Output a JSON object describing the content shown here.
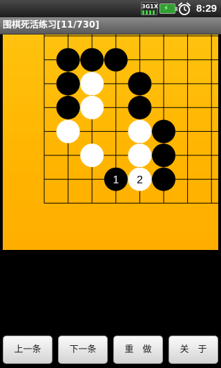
{
  "status_bar": {
    "network_label": "3G1X",
    "clock": "8:29",
    "icons": [
      "network-3g-icon",
      "battery-charging-icon",
      "alarm-clock-icon"
    ]
  },
  "title_bar": {
    "title": "围棋死活练习[11/730]"
  },
  "board": {
    "board_color": "#ffb800",
    "black_color": "#000000",
    "white_color": "#ffffff",
    "stones": [
      {
        "color": "black",
        "col": 1,
        "row": 1
      },
      {
        "color": "black",
        "col": 2,
        "row": 1
      },
      {
        "color": "black",
        "col": 3,
        "row": 1
      },
      {
        "color": "black",
        "col": 1,
        "row": 2
      },
      {
        "color": "white",
        "col": 2,
        "row": 2
      },
      {
        "color": "black",
        "col": 4,
        "row": 2
      },
      {
        "color": "black",
        "col": 1,
        "row": 3
      },
      {
        "color": "white",
        "col": 2,
        "row": 3
      },
      {
        "color": "black",
        "col": 4,
        "row": 3
      },
      {
        "color": "white",
        "col": 1,
        "row": 4
      },
      {
        "color": "white",
        "col": 4,
        "row": 4
      },
      {
        "color": "black",
        "col": 5,
        "row": 4
      },
      {
        "color": "white",
        "col": 2,
        "row": 5
      },
      {
        "color": "white",
        "col": 4,
        "row": 5
      },
      {
        "color": "black",
        "col": 5,
        "row": 5
      },
      {
        "color": "black",
        "col": 3,
        "row": 6,
        "label": "1"
      },
      {
        "color": "white",
        "col": 4,
        "row": 6,
        "label": "2"
      },
      {
        "color": "black",
        "col": 5,
        "row": 6
      }
    ]
  },
  "buttons": {
    "prev_label": "上一条",
    "next_label": "下一条",
    "redo_label": "重　做",
    "about_label": "关　于"
  }
}
